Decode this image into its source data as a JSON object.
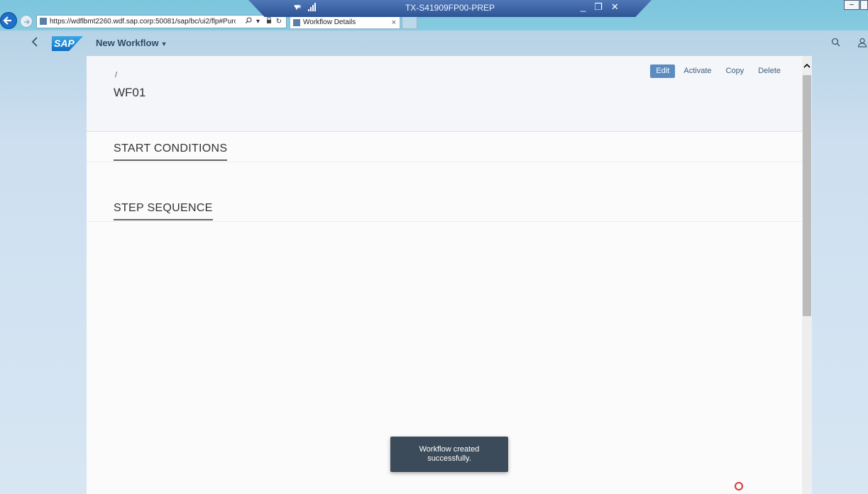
{
  "browser": {
    "url": "https://wdflbmt2260.wdf.sap.corp:50081/sap/bc/ui2/flp#Purchas",
    "tab_title": "Workflow Details",
    "tab_close": "×"
  },
  "rdp": {
    "title": "TX-S41909FP00-PREP"
  },
  "shell": {
    "logo": "SAP",
    "app_title": "New Workflow"
  },
  "page": {
    "breadcrumb": "/",
    "title": "WF01",
    "actions": {
      "edit": "Edit",
      "activate": "Activate",
      "copy": "Copy",
      "delete": "Delete"
    },
    "sections": {
      "start_conditions": "START CONDITIONS",
      "step_sequence": "STEP SEQUENCE"
    }
  },
  "toast": {
    "message": "Workflow created successfully."
  },
  "colors": {
    "primary_button": "#5a8cc1",
    "toast_bg": "#3b4b5a",
    "shell_text": "#2b4a6a"
  },
  "icons": [
    "back-arrow-icon",
    "forward-arrow-icon",
    "search-icon",
    "lock-icon",
    "refresh-icon",
    "user-icon",
    "chevron-up-icon",
    "pin-icon",
    "signal-icon"
  ]
}
